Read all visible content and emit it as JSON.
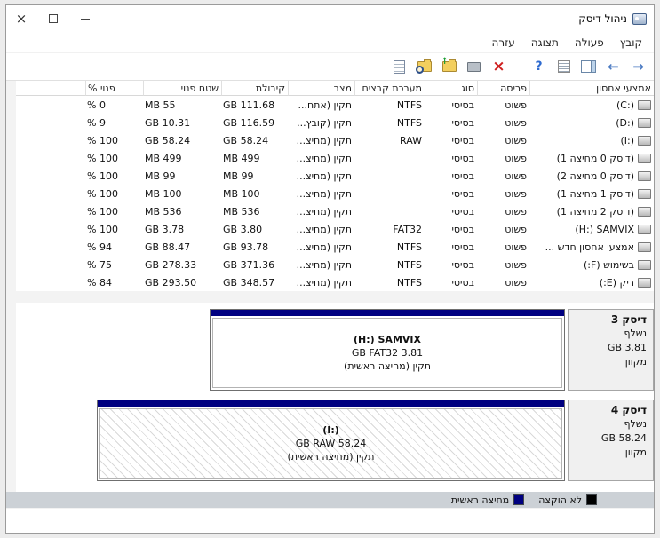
{
  "window": {
    "title": "ניהול דיסק",
    "controls": {
      "minimize_glyph": "–",
      "close_glyph": "×"
    }
  },
  "menu": {
    "items": [
      "קובץ",
      "פעולה",
      "תצוגה",
      "עזרה"
    ]
  },
  "toolbar": {
    "back_glyph": "→",
    "forward_glyph": "←",
    "help_glyph": "?",
    "delete_glyph": "×",
    "buttons": [
      "back",
      "forward",
      "show-console-tree",
      "export-list",
      "help",
      "delete-volume",
      "format",
      "open",
      "explore",
      "properties"
    ]
  },
  "table": {
    "columns": [
      "אמצעי אחסון",
      "פריסה",
      "סוג",
      "מערכת קבצים",
      "מצב",
      "קיבולת",
      "שטח פנוי",
      "% פנוי"
    ],
    "rows": [
      {
        "name": "(C:)",
        "layout": "פשוט",
        "type": "בסיסי",
        "fs": "NTFS",
        "status": "תקין (אתח...",
        "capacity": "111.68 GB",
        "free": "55 MB",
        "free_pct": "0 %"
      },
      {
        "name": "(D:)",
        "layout": "פשוט",
        "type": "בסיסי",
        "fs": "NTFS",
        "status": "תקין (קובץ...",
        "capacity": "116.59 GB",
        "free": "10.31 GB",
        "free_pct": "9 %"
      },
      {
        "name": "(I:)",
        "layout": "פשוט",
        "type": "בסיסי",
        "fs": "RAW",
        "status": "תקין (מחיצ...",
        "capacity": "58.24 GB",
        "free": "58.24 GB",
        "free_pct": "100 %"
      },
      {
        "name": "(דיסק 0 מחיצה 1)",
        "layout": "פשוט",
        "type": "בסיסי",
        "fs": "",
        "status": "תקין (מחיצ...",
        "capacity": "499 MB",
        "free": "499 MB",
        "free_pct": "100 %"
      },
      {
        "name": "(דיסק 0 מחיצה 2)",
        "layout": "פשוט",
        "type": "בסיסי",
        "fs": "",
        "status": "תקין (מחיצ...",
        "capacity": "99 MB",
        "free": "99 MB",
        "free_pct": "100 %"
      },
      {
        "name": "(דיסק 1 מחיצה 1)",
        "layout": "פשוט",
        "type": "בסיסי",
        "fs": "",
        "status": "תקין (מחיצ...",
        "capacity": "100 MB",
        "free": "100 MB",
        "free_pct": "100 %"
      },
      {
        "name": "(דיסק 2 מחיצה 1)",
        "layout": "פשוט",
        "type": "בסיסי",
        "fs": "",
        "status": "תקין (מחיצ...",
        "capacity": "536 MB",
        "free": "536 MB",
        "free_pct": "100 %"
      },
      {
        "name": "(H:) SAMVIX",
        "layout": "פשוט",
        "type": "בסיסי",
        "fs": "FAT32",
        "status": "תקין (מחיצ...",
        "capacity": "3.80 GB",
        "free": "3.78 GB",
        "free_pct": "100 %"
      },
      {
        "name": "אמצעי אחסון חדש ...",
        "layout": "פשוט",
        "type": "בסיסי",
        "fs": "NTFS",
        "status": "תקין (מחיצ...",
        "capacity": "93.78 GB",
        "free": "88.47 GB",
        "free_pct": "94 %"
      },
      {
        "name": "בשימוש (F:)",
        "layout": "פשוט",
        "type": "בסיסי",
        "fs": "NTFS",
        "status": "תקין (מחיצ...",
        "capacity": "371.36 GB",
        "free": "278.33 GB",
        "free_pct": "75 %"
      },
      {
        "name": "ריק (E:)",
        "layout": "פשוט",
        "type": "בסיסי",
        "fs": "NTFS",
        "status": "תקין (מחיצ...",
        "capacity": "348.57 GB",
        "free": "293.50 GB",
        "free_pct": "84 %"
      }
    ]
  },
  "graphical": {
    "disks": [
      {
        "title": "דיסק 3",
        "kind": "נשלף",
        "size": "3.81 GB",
        "status": "מקוון",
        "partition": {
          "title": "(H:) SAMVIX",
          "size_fs": "3.81 GB FAT32",
          "status": "תקין (מחיצה ראשית)"
        }
      },
      {
        "title": "דיסק 4",
        "kind": "נשלף",
        "size": "58.24 GB",
        "status": "מקוון",
        "partition": {
          "title": "(I:)",
          "size_fs": "58.24 GB RAW",
          "status": "תקין (מחיצה ראשית)"
        }
      }
    ]
  },
  "legend": {
    "items": [
      {
        "label": "לא הוקצה",
        "color": "#000000"
      },
      {
        "label": "מחיצה ראשית",
        "color": "#000080"
      }
    ]
  },
  "colors": {
    "primary_partition": "#000080",
    "unallocated": "#000000"
  }
}
